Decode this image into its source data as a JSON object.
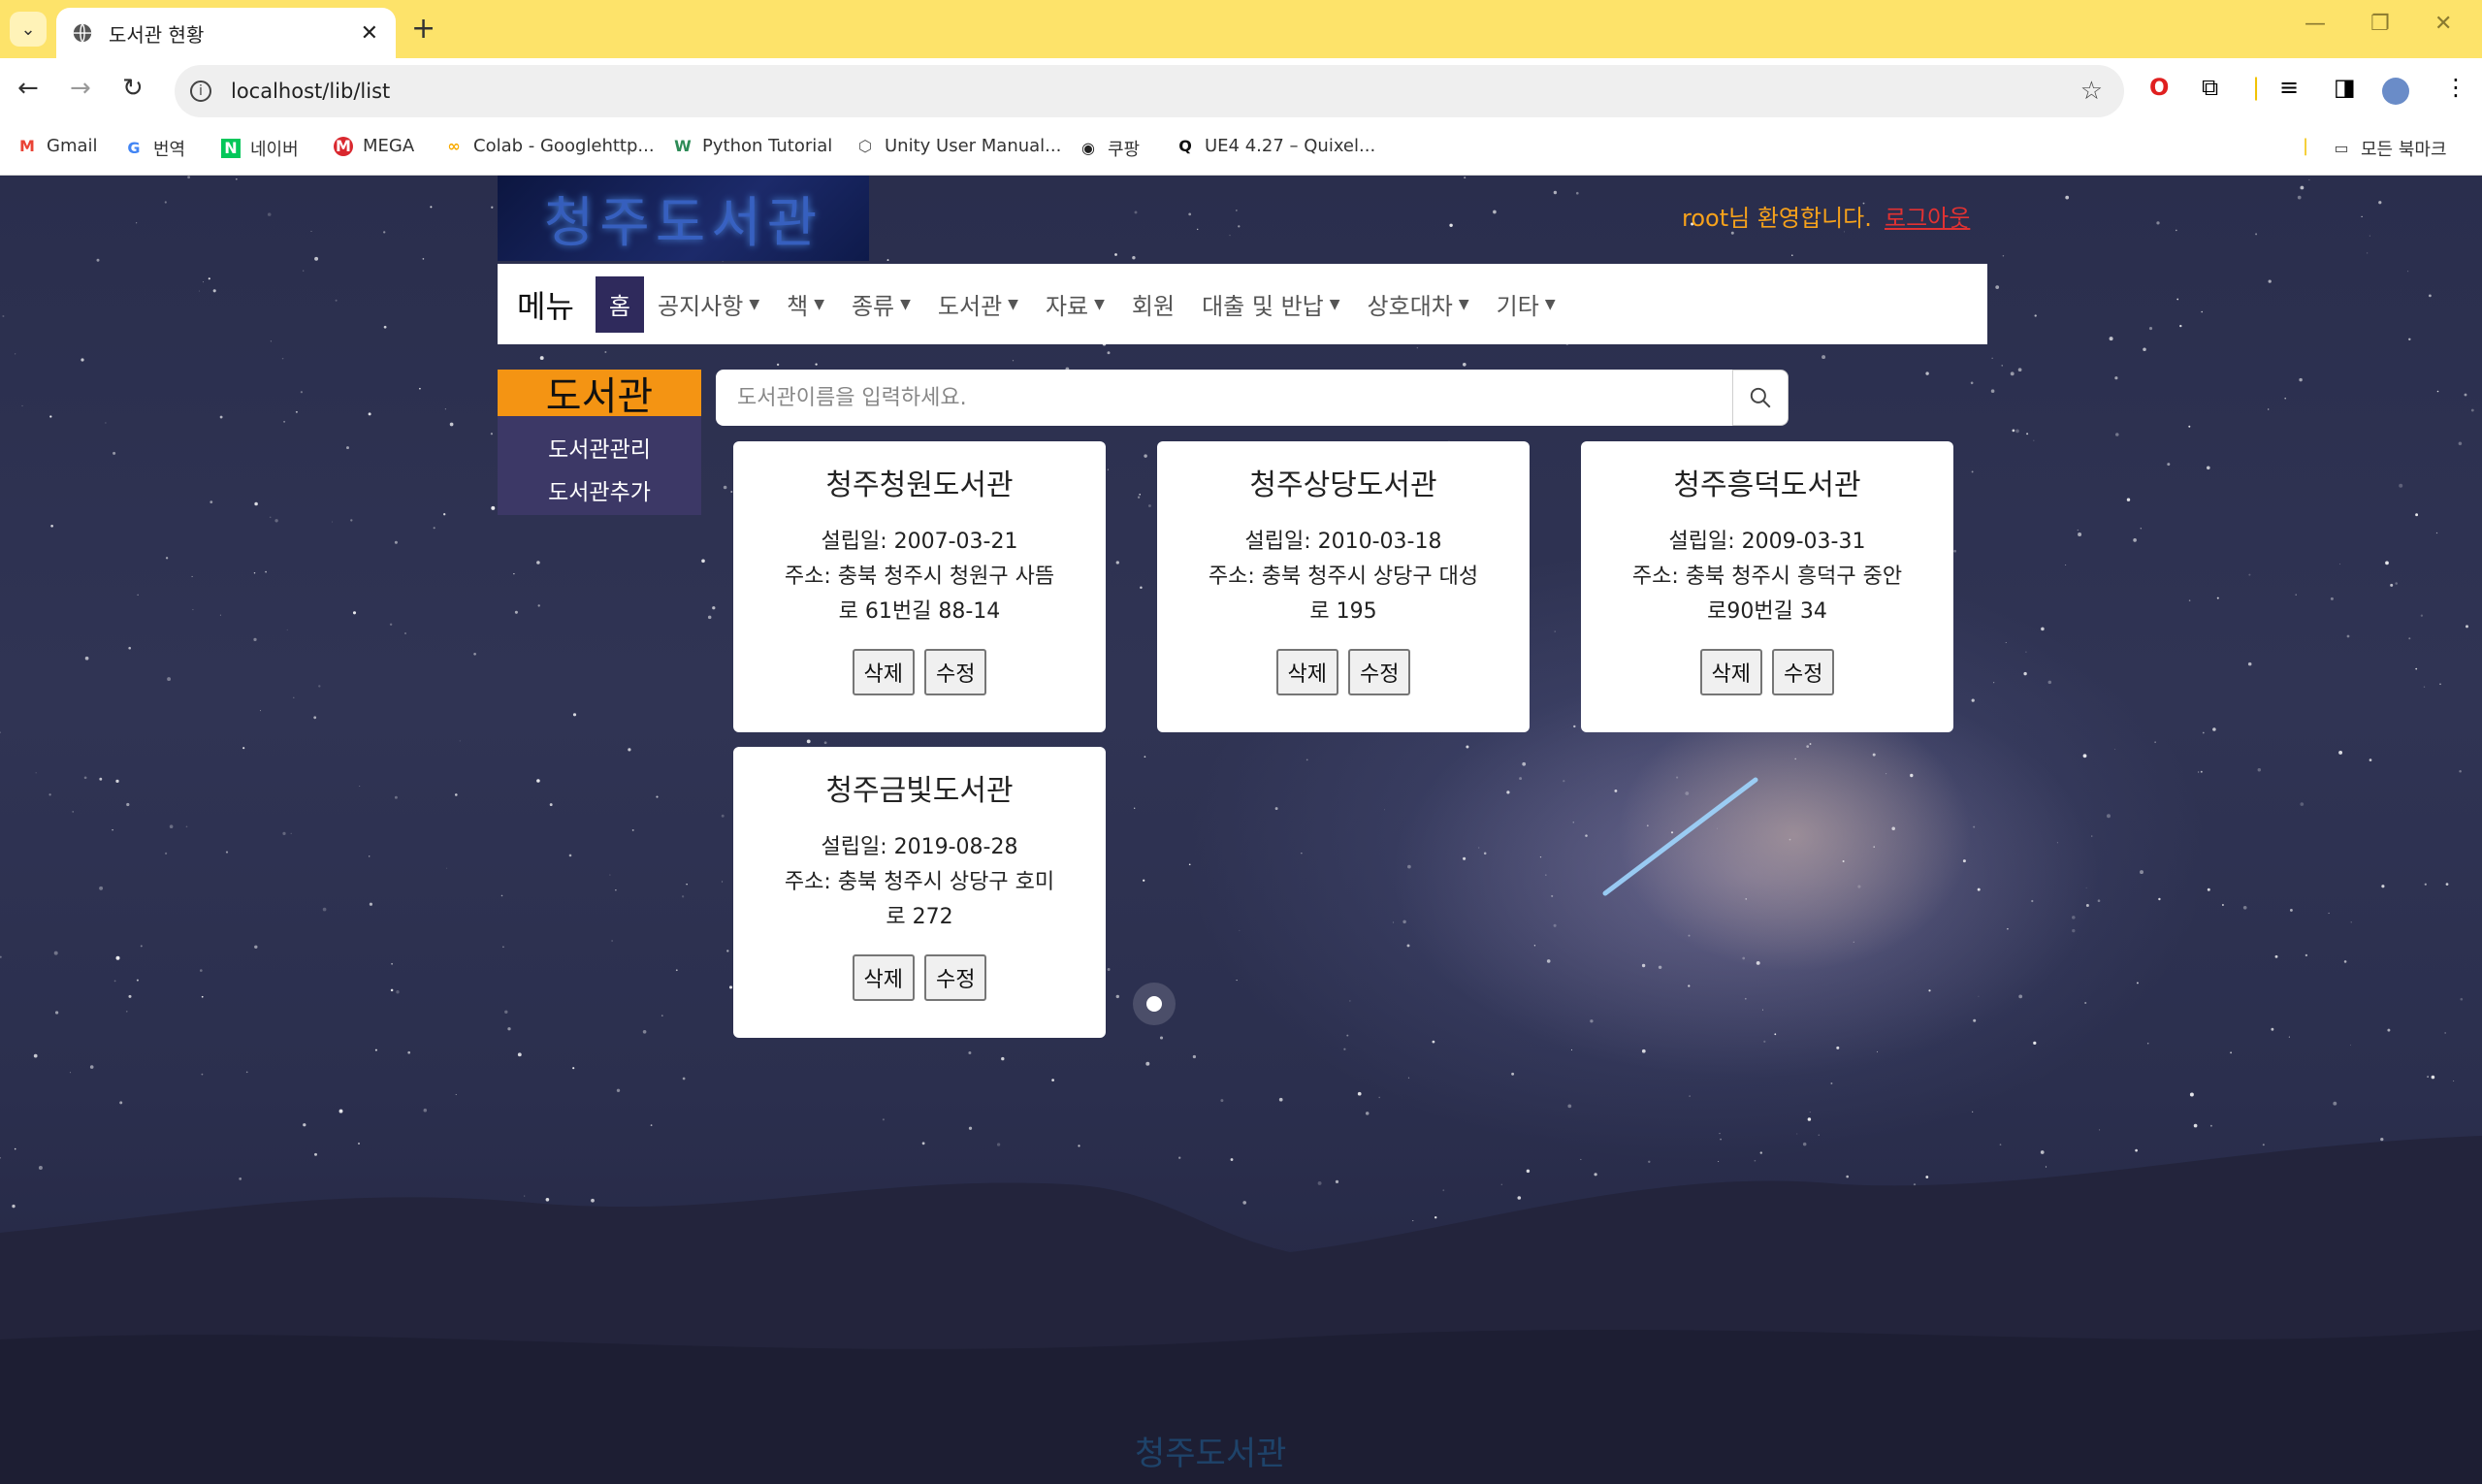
{
  "browser": {
    "tab_title": "도서관 현황",
    "url": "localhost/lib/list",
    "bookmarks": [
      {
        "label": "Gmail",
        "icon": "gmail-icon",
        "color": "#ea4335"
      },
      {
        "label": "번역",
        "icon": "translate-icon",
        "color": "#4285f4"
      },
      {
        "label": "네이버",
        "icon": "naver-icon",
        "color": "#03c75a"
      },
      {
        "label": "MEGA",
        "icon": "mega-icon",
        "color": "#d9272e"
      },
      {
        "label": "Colab - Googlehttp...",
        "icon": "colab-icon",
        "color": "#f9ab00"
      },
      {
        "label": "Python Tutorial",
        "icon": "python-tutorial-icon",
        "color": "#2e8b57"
      },
      {
        "label": "Unity User Manual...",
        "icon": "unity-icon",
        "color": "#555555"
      },
      {
        "label": "쿠팡",
        "icon": "globe-icon",
        "color": "#222222"
      },
      {
        "label": "UE4 4.27 – Quixel...",
        "icon": "quixel-icon",
        "color": "#111111"
      }
    ],
    "bookmarks_folder": "모든 북마크"
  },
  "header": {
    "logo_text": "청주도서관",
    "welcome": "root님 환영합니다.",
    "logout": "로그아웃"
  },
  "nav": {
    "brand": "메뉴",
    "home": "홈",
    "items": [
      "공지사항",
      "책",
      "종류",
      "도서관",
      "자료",
      "회원",
      "대출 및 반납",
      "상호대차",
      "기타"
    ]
  },
  "sidebar": {
    "title": "도서관",
    "items": [
      "도서관관리",
      "도서관추가"
    ]
  },
  "search": {
    "placeholder": "도서관이름을 입력하세요."
  },
  "libraries": [
    {
      "name": "청주청원도서관",
      "established": "설립일: 2007-03-21",
      "address_1": "주소: 충북 청주시 청원구 사뜸",
      "address_2": "로 61번길 88-14",
      "delete": "삭제",
      "edit": "수정"
    },
    {
      "name": "청주상당도서관",
      "established": "설립일: 2010-03-18",
      "address_1": "주소: 충북 청주시 상당구 대성",
      "address_2": "로 195",
      "delete": "삭제",
      "edit": "수정"
    },
    {
      "name": "청주흥덕도서관",
      "established": "설립일: 2009-03-31",
      "address_1": "주소: 충북 청주시 흥덕구 중안",
      "address_2": "로90번길 34",
      "delete": "삭제",
      "edit": "수정"
    },
    {
      "name": "청주금빛도서관",
      "established": "설립일: 2019-08-28",
      "address_1": "주소: 충북 청주시 상당구 호미",
      "address_2": "로 272",
      "delete": "삭제",
      "edit": "수정"
    }
  ],
  "footer": {
    "text": "청주도서관"
  },
  "colors": {
    "tabbar": "#fde36a",
    "accent_orange": "#f49413",
    "nav_active": "#2f2a5c",
    "sidebar_bg": "#3c3866",
    "logout": "#e23232"
  }
}
